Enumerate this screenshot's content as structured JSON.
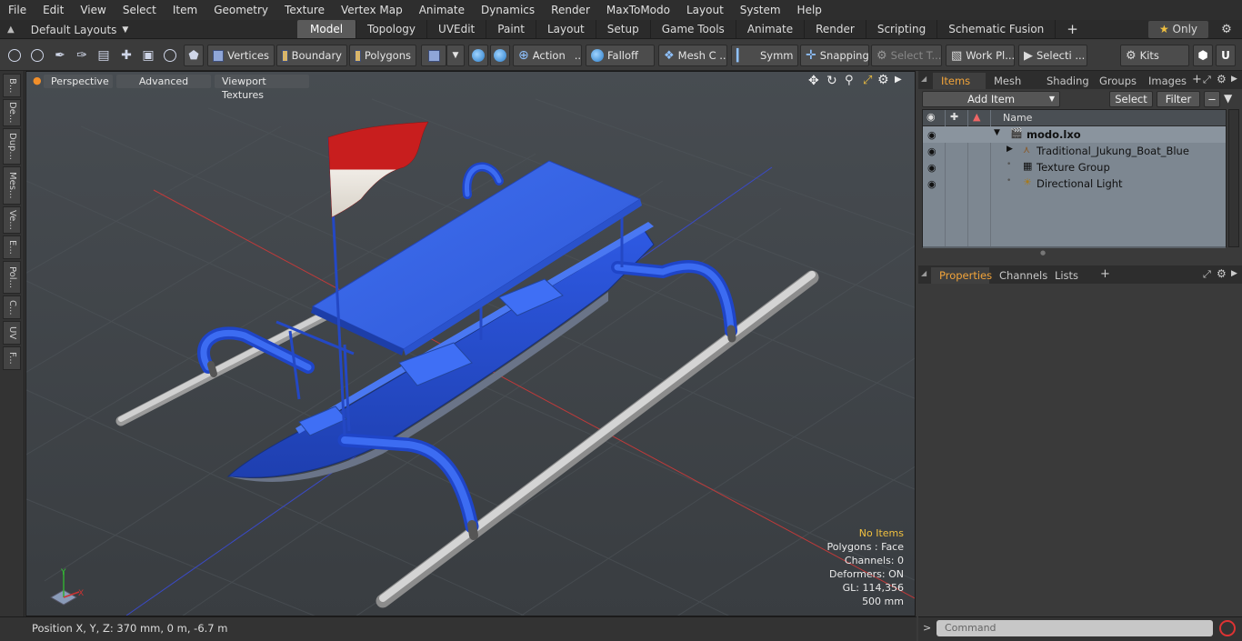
{
  "menu": [
    "File",
    "Edit",
    "View",
    "Select",
    "Item",
    "Geometry",
    "Texture",
    "Vertex Map",
    "Animate",
    "Dynamics",
    "Render",
    "MaxToModo",
    "Layout",
    "System",
    "Help"
  ],
  "layout_selector": "Default Layouts",
  "layout_tabs": [
    "Model",
    "Topology",
    "UVEdit",
    "Paint",
    "Layout",
    "Setup",
    "Game Tools",
    "Animate",
    "Render",
    "Scripting",
    "Schematic Fusion"
  ],
  "active_tab": "Model",
  "only_button": "Only",
  "toolbar": {
    "vertices": "Vertices",
    "boundary": "Boundary",
    "polygons": "Polygons",
    "action": "Action",
    "falloff": "Falloff",
    "mesh_c": "Mesh C ...",
    "symm": "Symm ...",
    "snapping": "Snapping",
    "select_t": "Select T...",
    "work_pl": "Work Pl...",
    "selecti": "Selecti ...",
    "kits": "Kits"
  },
  "left_tabs": [
    "B...",
    "De...",
    "Dup...",
    "Mes...",
    "Ve...",
    "E...",
    "Pol...",
    "C...",
    "UV",
    "F..."
  ],
  "viewport": {
    "perspective": "Perspective",
    "advanced": "Advanced",
    "textures": "Viewport Textures",
    "info": {
      "no_items": "No Items",
      "polygons": "Polygons : Face",
      "channels": "Channels: 0",
      "deformers": "Deformers: ON",
      "gl": "GL: 114,356",
      "scale": "500 mm"
    }
  },
  "items_panel": {
    "tabs": [
      "Items",
      "Mesh ...",
      "Shading",
      "Groups",
      "Images"
    ],
    "active_tab": "Items",
    "add_item": "Add Item",
    "select": "Select",
    "filter": "Filter",
    "name_header": "Name",
    "rows": [
      {
        "label": "modo.lxo"
      },
      {
        "label": "Traditional_Jukung_Boat_Blue"
      },
      {
        "label": "Texture Group"
      },
      {
        "label": "Directional Light"
      }
    ]
  },
  "properties_panel": {
    "tabs": [
      "Properties",
      "Channels",
      "Lists"
    ],
    "active_tab": "Properties"
  },
  "status": {
    "position": "Position X, Y, Z:  370 mm, 0 m, -6.7 m"
  },
  "command": {
    "placeholder": "Command"
  },
  "colors": {
    "accent": "#f2a43a",
    "boat_blue": "#2f5ee0",
    "flag_red": "#c81e1e"
  }
}
